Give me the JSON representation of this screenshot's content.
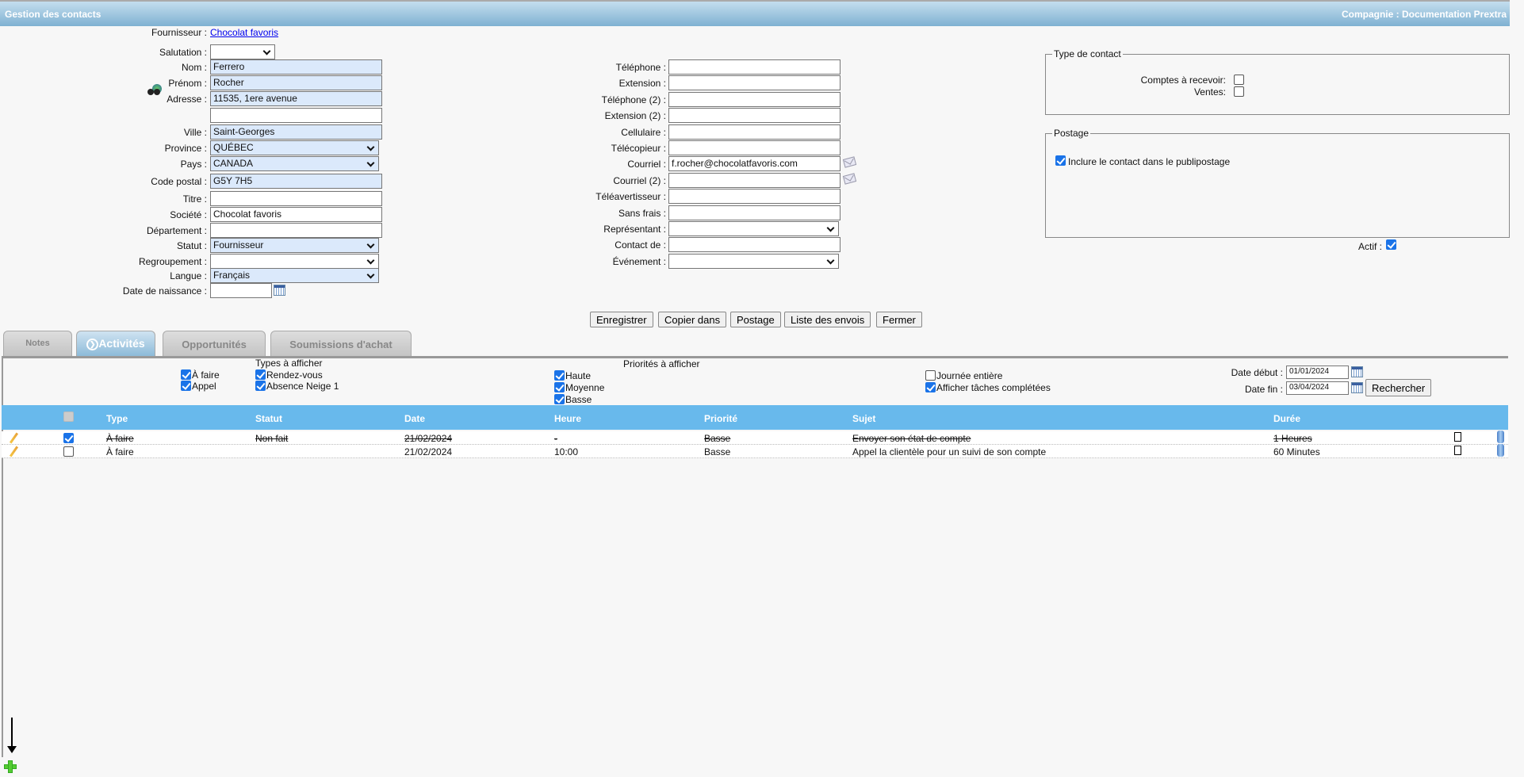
{
  "header": {
    "title": "Gestion des contacts",
    "company": "Compagnie : Documentation Prextra"
  },
  "supplier": {
    "label": "Fournisseur :",
    "link": "Chocolat favoris"
  },
  "left_fields": [
    {
      "label": "Salutation :",
      "value": "",
      "kind": "select",
      "blue": false
    },
    {
      "label": "Nom :",
      "value": "Ferrero",
      "kind": "text",
      "blue": true
    },
    {
      "label": "Prénom :",
      "value": "Rocher",
      "kind": "text",
      "blue": true
    },
    {
      "label": "Adresse :",
      "value": "11535, 1ere avenue",
      "kind": "text",
      "blue": true
    },
    {
      "label": "",
      "value": "",
      "kind": "text",
      "blue": false
    },
    {
      "label": "Ville :",
      "value": "Saint-Georges",
      "kind": "text",
      "blue": true
    },
    {
      "label": "Province :",
      "value": "QUÉBEC",
      "kind": "select",
      "blue": true
    },
    {
      "label": "Pays :",
      "value": "CANADA",
      "kind": "select",
      "blue": true
    },
    {
      "label": "Code postal :",
      "value": "G5Y 7H5",
      "kind": "text",
      "blue": true
    },
    {
      "label": "Titre :",
      "value": "",
      "kind": "text",
      "blue": false
    },
    {
      "label": "Société :",
      "value": "Chocolat favoris",
      "kind": "text",
      "blue": false
    },
    {
      "label": "Département :",
      "value": "",
      "kind": "text",
      "blue": false
    },
    {
      "label": "Statut :",
      "value": "Fournisseur",
      "kind": "select",
      "blue": true
    },
    {
      "label": "Regroupement :",
      "value": "",
      "kind": "select",
      "blue": false
    },
    {
      "label": "Langue :",
      "value": "Français",
      "kind": "select",
      "blue": true
    },
    {
      "label": "Date de naissance :",
      "value": "",
      "kind": "date",
      "blue": false
    }
  ],
  "middle_fields": [
    {
      "label": "Téléphone :",
      "value": "",
      "kind": "text"
    },
    {
      "label": "Extension :",
      "value": "",
      "kind": "text"
    },
    {
      "label": "Téléphone (2) :",
      "value": "",
      "kind": "text"
    },
    {
      "label": "Extension (2) :",
      "value": "",
      "kind": "text"
    },
    {
      "label": "Cellulaire :",
      "value": "",
      "kind": "text"
    },
    {
      "label": "Télécopieur :",
      "value": "",
      "kind": "text"
    },
    {
      "label": "Courriel :",
      "value": "f.rocher@chocolatfavoris.com",
      "kind": "email"
    },
    {
      "label": "Courriel (2) :",
      "value": "",
      "kind": "email"
    },
    {
      "label": "Téléavertisseur :",
      "value": "",
      "kind": "text"
    },
    {
      "label": "Sans frais :",
      "value": "",
      "kind": "text"
    },
    {
      "label": "Représentant :",
      "value": "",
      "kind": "select"
    },
    {
      "label": "Contact de :",
      "value": "",
      "kind": "text"
    },
    {
      "label": "Événement :",
      "value": "",
      "kind": "select"
    }
  ],
  "contact_type": {
    "legend": "Type de contact",
    "receivable_label": "Comptes à recevoir:",
    "receivable": false,
    "sales_label": "Ventes:",
    "sales": false
  },
  "mailing": {
    "legend": "Postage",
    "include_label": "Inclure le contact dans le publipostage",
    "include": true
  },
  "active": {
    "label": "Actif :",
    "checked": true
  },
  "buttons": [
    "Enregistrer",
    "Copier dans",
    "Postage",
    "Liste des envois",
    "Fermer"
  ],
  "tabs": [
    {
      "label": "Notes",
      "active": false
    },
    {
      "label": "Activités",
      "active": true
    },
    {
      "label": "Opportunités",
      "active": false
    },
    {
      "label": "Soumissions d'achat",
      "active": false
    }
  ],
  "filters": {
    "types_title": "Types à afficher",
    "types": [
      {
        "label": "À faire",
        "checked": true
      },
      {
        "label": "Appel",
        "checked": true
      },
      {
        "label": "Rendez-vous",
        "checked": true
      },
      {
        "label": "Absence Neige 1",
        "checked": true
      }
    ],
    "priorities_title": "Priorités à afficher",
    "priorities": [
      {
        "label": "Haute",
        "checked": true
      },
      {
        "label": "Moyenne",
        "checked": true
      },
      {
        "label": "Basse",
        "checked": true
      }
    ],
    "all_day": {
      "label": "Journée entière",
      "checked": false
    },
    "show_completed": {
      "label": "Afficher tâches complétées",
      "checked": true
    },
    "start_label": "Date début :",
    "start": "01/01/2024",
    "end_label": "Date fin :",
    "end": "03/04/2024",
    "search": "Rechercher"
  },
  "table": {
    "columns": [
      "Type",
      "Statut",
      "Date",
      "Heure",
      "Priorité",
      "Sujet",
      "Durée"
    ],
    "rows": [
      {
        "done": true,
        "type": "À faire",
        "status": "Non fait",
        "date": "21/02/2024",
        "time": "-",
        "priority": "Basse",
        "subject": "Envoyer son état de compte",
        "duration": "1 Heures"
      },
      {
        "done": false,
        "type": "À faire",
        "status": "",
        "date": "21/02/2024",
        "time": "10:00",
        "priority": "Basse",
        "subject": "Appel la clientèle pour un suivi de son compte",
        "duration": "60 Minutes"
      }
    ]
  },
  "colors": {
    "header_table": "#68b9ec",
    "checkbox": "#1a73e8",
    "link": "#0000ee"
  }
}
